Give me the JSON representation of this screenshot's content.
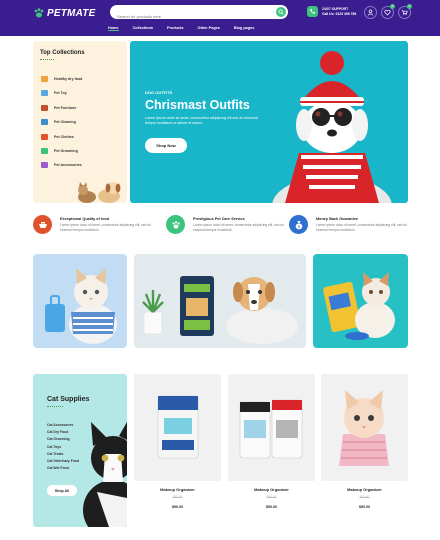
{
  "brand": {
    "logo_text": "PETMATE"
  },
  "search": {
    "placeholder": "Search for products here"
  },
  "support": {
    "line1": "24X/7 SUPPORT",
    "line2": "Call Us: 0123 456 789"
  },
  "header_icons": {
    "wishlist_count": "0",
    "cart_count": "0"
  },
  "nav": {
    "items": [
      "Home",
      "Collections",
      "Products",
      "Other Pages",
      "Blog pages"
    ]
  },
  "collections": {
    "title": "Top Collections",
    "items": [
      "Healthy dry food",
      "Pet Toy",
      "Pet Furniture",
      "Pet Cleaning",
      "Pet Clothes",
      "Pet Grooming",
      "Pet Accessories"
    ]
  },
  "hero": {
    "eyebrow": "DOG OUTFITS",
    "title": "Chrismast Outfits",
    "subtitle": "Lorem ipsum dolor sit amet, consectetur adipiscing elit sed do eiusmod tempor incididunt ut labore et dolore",
    "button": "Shop Now"
  },
  "features": [
    {
      "title": "Exceptional Quality of food",
      "text": "Lorem ipsum dolor sit amet, consectetur adipiscing elit, sed do eiusmod tempor incididunt",
      "color": "#e0522b"
    },
    {
      "title": "Prestigious Pet Care Service",
      "text": "Lorem ipsum dolor sit amet, consectetur adipiscing elit, sed do eiusmod tempor incididunt",
      "color": "#3cc47c"
    },
    {
      "title": "Money Back Guarantee",
      "text": "Lorem ipsum dolor sit amet, consectetur adipiscing elit, sed do eiusmod tempor incididunt",
      "color": "#2f6fd0"
    }
  ],
  "supplies": {
    "title": "Cat Supplies",
    "items": [
      "Cat Accessories",
      "Cat Dry Food",
      "Cat Grooming",
      "Cat Toys",
      "Cat Treats",
      "Cat Veterinary Food",
      "Cat Wet Food"
    ],
    "button": "Shop All"
  },
  "products": [
    {
      "name": "Makeup Organizer",
      "old_price": "$90.00",
      "price": "$90.00"
    },
    {
      "name": "Makeup Organizer",
      "old_price": "$90.00",
      "price": "$90.00"
    },
    {
      "name": "Makeup Organizer",
      "old_price": "$90.00",
      "price": "$90.00"
    }
  ],
  "colors": {
    "header": "#3a1d8f",
    "accent": "#3cc47c",
    "hero": "#19b5c8",
    "collections_bg": "#fdf2dd",
    "supplies_bg": "#b4e8e6"
  }
}
